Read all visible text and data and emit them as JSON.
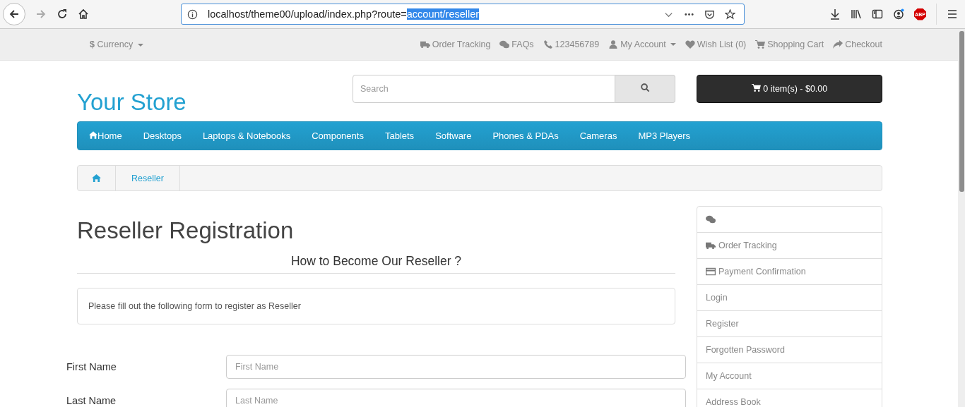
{
  "browser": {
    "url": "localhost/theme00/upload/index.php?route=",
    "url_selected": "account/reseller",
    "addon_label": "ABP"
  },
  "top_bar": {
    "currency_symbol": "$",
    "currency": "Currency",
    "links": [
      {
        "label": "Order Tracking",
        "dropdown": false
      },
      {
        "label": "FAQs",
        "dropdown": false
      },
      {
        "label": "123456789",
        "dropdown": false
      },
      {
        "label": "My Account",
        "dropdown": true
      },
      {
        "label": "Wish List (0)",
        "dropdown": false
      },
      {
        "label": "Shopping Cart",
        "dropdown": false
      },
      {
        "label": "Checkout",
        "dropdown": false
      }
    ]
  },
  "header": {
    "logo": "Your Store",
    "search": {
      "placeholder": "Search"
    },
    "cart": "0 item(s) - $0.00"
  },
  "menu": [
    "Home",
    "Desktops",
    "Laptops & Notebooks",
    "Components",
    "Tablets",
    "Software",
    "Phones & PDAs",
    "Cameras",
    "MP3 Players"
  ],
  "breadcrumb": [
    "Reseller"
  ],
  "content": {
    "title": "Reseller Registration",
    "subtitle": "How to Become Our Reseller ?",
    "notice": "Please fill out the following form to register as Reseller",
    "fields": [
      {
        "label": "First Name",
        "placeholder": "First Name"
      },
      {
        "label": "Last Name",
        "placeholder": "Last Name"
      }
    ]
  },
  "sidebar": {
    "items": [
      "Order Tracking",
      "Payment Confirmation",
      "Login",
      "Register",
      "Forgotten Password",
      "My Account",
      "Address Book"
    ]
  }
}
